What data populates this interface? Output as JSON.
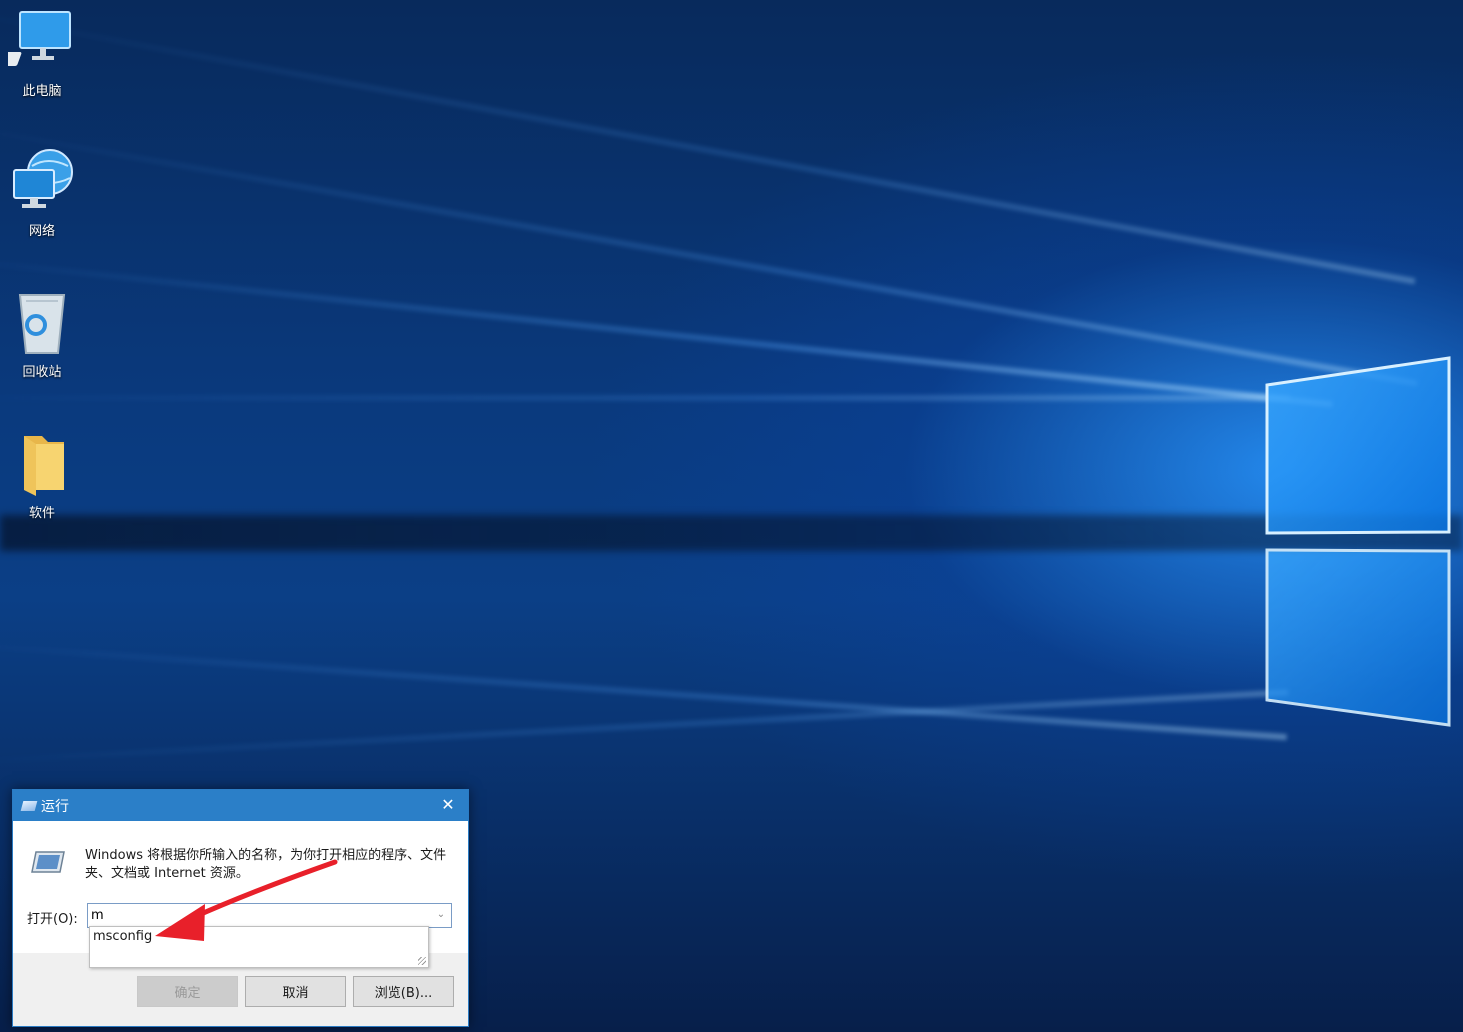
{
  "desktop": {
    "icons": [
      {
        "label": "此电脑",
        "icon": "computer-icon"
      },
      {
        "label": "网络",
        "icon": "network-icon"
      },
      {
        "label": "回收站",
        "icon": "recycle-bin-icon"
      },
      {
        "label": "软件",
        "icon": "folder-icon"
      }
    ]
  },
  "run_dialog": {
    "title": "运行",
    "description": "Windows 将根据你所输入的名称，为你打开相应的程序、文件夹、文档或 Internet 资源。",
    "open_label": "打开(O):",
    "input_value": "m",
    "suggestion": "msconfig",
    "ok_label": "确定",
    "cancel_label": "取消",
    "browse_label": "浏览(B)..."
  },
  "colors": {
    "titlebar": "#2b7fc8",
    "annotation_arrow": "#e8202a"
  }
}
